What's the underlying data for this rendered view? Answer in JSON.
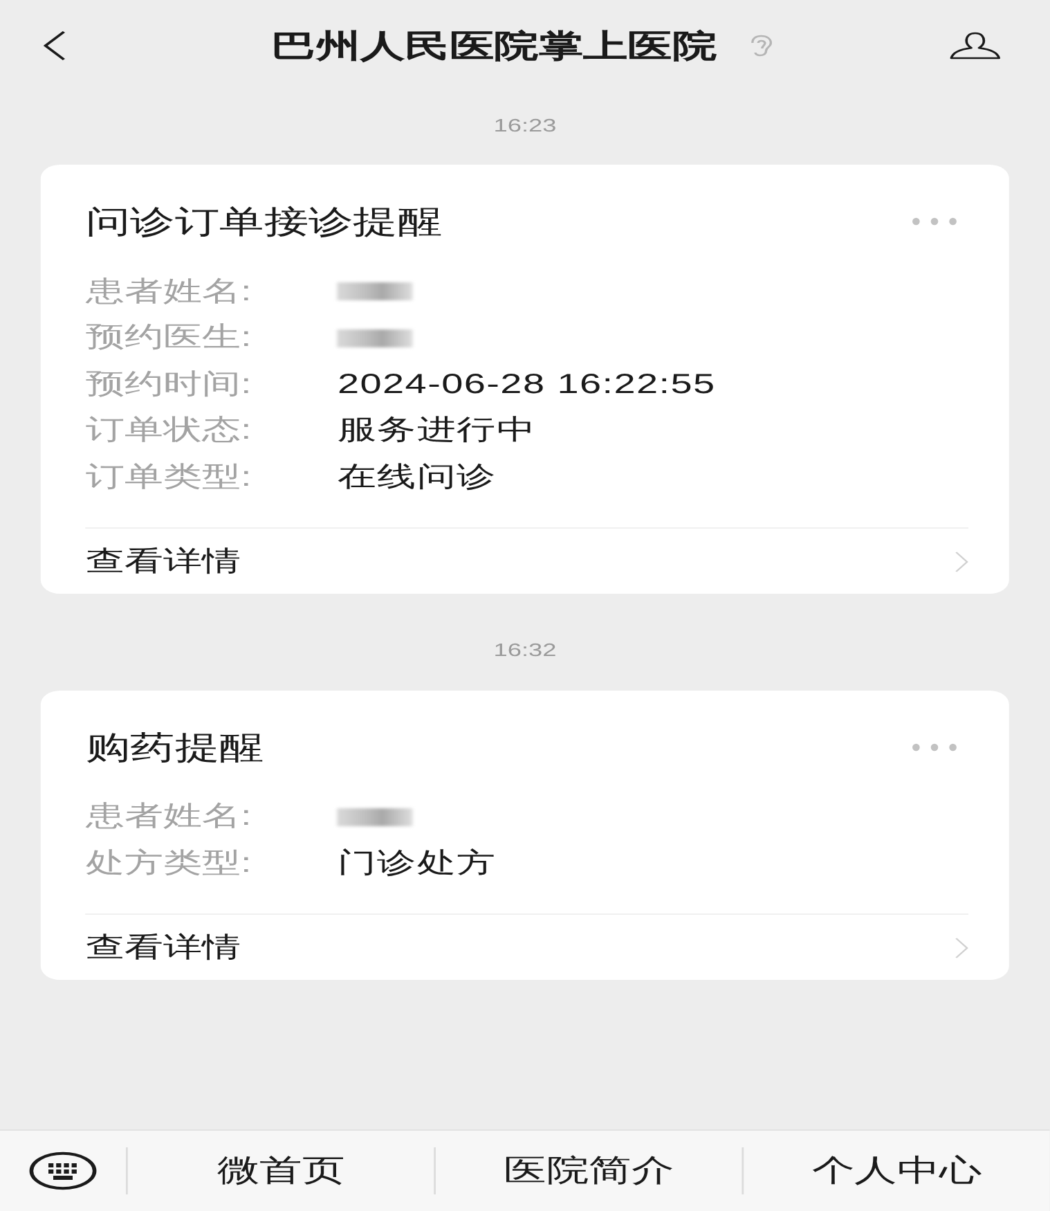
{
  "header": {
    "title": "巴州人民医院掌上医院"
  },
  "messages": [
    {
      "time": "16:23",
      "card": {
        "title": "问诊订单接诊提醒",
        "fields": [
          {
            "label": "患者姓名:",
            "kind": "blurred"
          },
          {
            "label": "预约医生:",
            "kind": "blurred"
          },
          {
            "label": "预约时间:",
            "kind": "text",
            "value": "2024-06-28 16:22:55"
          },
          {
            "label": "订单状态:",
            "kind": "text",
            "value": "服务进行中"
          },
          {
            "label": "订单类型:",
            "kind": "text",
            "value": "在线问诊"
          }
        ],
        "link": "查看详情"
      }
    },
    {
      "time": "16:32",
      "card": {
        "title": "购药提醒",
        "fields": [
          {
            "label": "患者姓名:",
            "kind": "blurred"
          },
          {
            "label": "处方类型:",
            "kind": "text",
            "value": "门诊处方"
          }
        ],
        "link": "查看详情"
      }
    }
  ],
  "bottom_menu": {
    "items": [
      "微首页",
      "医院简介",
      "个人中心"
    ]
  }
}
